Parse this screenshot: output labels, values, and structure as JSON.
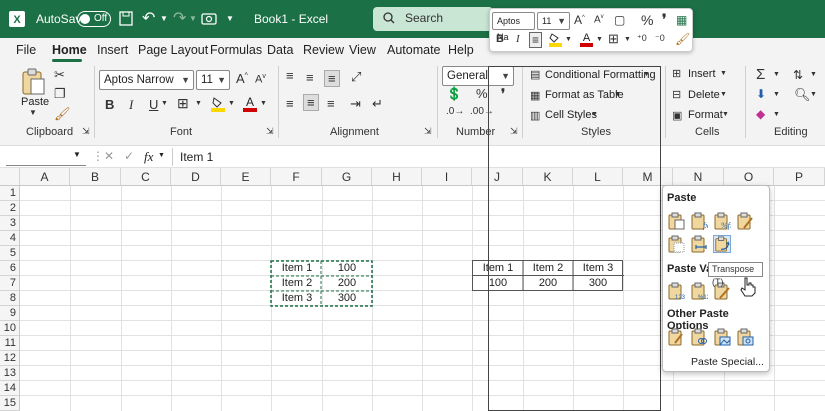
{
  "titlebar": {
    "autosave_label": "AutoSave",
    "autosave_state": "Off",
    "doc_title": "Book1 - Excel",
    "search_placeholder": "Search"
  },
  "menu": [
    "File",
    "Home",
    "Insert",
    "Page Layout",
    "Formulas",
    "Data",
    "Review",
    "View",
    "Automate",
    "Help"
  ],
  "active_tab": "Home",
  "ribbon": {
    "clipboard": {
      "label": "Clipboard",
      "paste": "Paste"
    },
    "font": {
      "label": "Font",
      "name": "Aptos Narrow",
      "size": "11"
    },
    "alignment": {
      "label": "Alignment"
    },
    "number": {
      "label": "Number",
      "format": "General"
    },
    "styles": {
      "label": "Styles",
      "conditional": "Conditional Formatting",
      "format_table": "Format as Table",
      "cell_styles": "Cell Styles"
    },
    "cells": {
      "label": "Cells",
      "insert": "Insert",
      "delete": "Delete",
      "format": "Format"
    },
    "editing": {
      "label": "Editing"
    }
  },
  "qat": {
    "font": "Aptos Na",
    "size": "11"
  },
  "formula_bar": {
    "fx": "fx",
    "value": "Item 1"
  },
  "columns": [
    "A",
    "B",
    "C",
    "D",
    "E",
    "F",
    "G",
    "H",
    "I",
    "J",
    "K",
    "L",
    "M",
    "N",
    "O",
    "P"
  ],
  "rows": [
    "1",
    "2",
    "3",
    "4",
    "5",
    "6",
    "7",
    "8",
    "9",
    "10",
    "11",
    "12",
    "13",
    "14",
    "15"
  ],
  "source_table": [
    [
      "Item 1",
      "100"
    ],
    [
      "Item 2",
      "200"
    ],
    [
      "Item 3",
      "300"
    ]
  ],
  "transposed_table": [
    [
      "Item 1",
      "Item 2",
      "Item 3"
    ],
    [
      "100",
      "200",
      "300"
    ]
  ],
  "paste_menu": {
    "paste": "Paste",
    "paste_values": "Paste Val",
    "other": "Other Paste Options",
    "special": "Paste Special...",
    "tooltip": "Transpose (T)"
  },
  "colors": {
    "brand": "#1b7045",
    "accent_fill": "#ffd700",
    "font_red": "#d00000"
  }
}
